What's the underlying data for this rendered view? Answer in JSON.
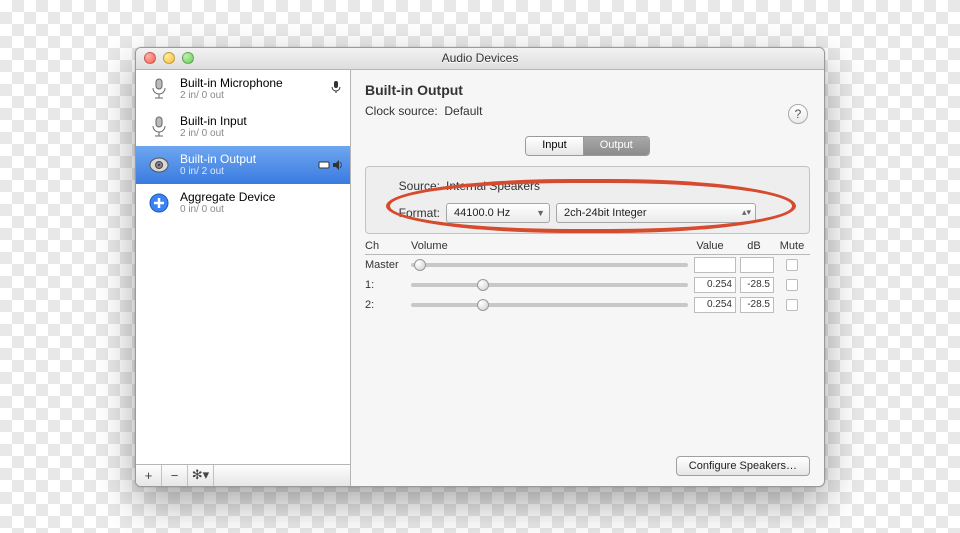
{
  "window": {
    "title": "Audio Devices"
  },
  "sidebar": {
    "devices": [
      {
        "name": "Built-in Microphone",
        "io": "2 in/ 0 out",
        "default_mic_badge": true
      },
      {
        "name": "Built-in Input",
        "io": "2 in/ 0 out"
      },
      {
        "name": "Built-in Output",
        "io": "0 in/ 2 out",
        "selected": true,
        "default_out_badge": true
      },
      {
        "name": "Aggregate Device",
        "io": "0 in/ 0 out"
      }
    ],
    "footer": {
      "add": "+",
      "remove": "−",
      "gear": "✻▾"
    }
  },
  "main": {
    "device_title": "Built-in Output",
    "clock_label": "Clock source:",
    "clock_value": "Default",
    "help": "?",
    "tabs": {
      "input": "Input",
      "output": "Output",
      "active": "output"
    },
    "source_label": "Source:",
    "source_value": "Internal Speakers",
    "format_label": "Format:",
    "format_rate": "44100.0 Hz",
    "format_depth": "2ch-24bit Integer",
    "volume": {
      "headers": {
        "ch": "Ch",
        "vol": "Volume",
        "value": "Value",
        "db": "dB",
        "mute": "Mute"
      },
      "rows": [
        {
          "ch": "Master",
          "pos": 1,
          "value": "",
          "db": "",
          "mute": false
        },
        {
          "ch": "1:",
          "pos": 25,
          "value": "0.254",
          "db": "-28.5",
          "mute": false
        },
        {
          "ch": "2:",
          "pos": 25,
          "value": "0.254",
          "db": "-28.5",
          "mute": false
        }
      ]
    },
    "configure_btn": "Configure Speakers…"
  }
}
